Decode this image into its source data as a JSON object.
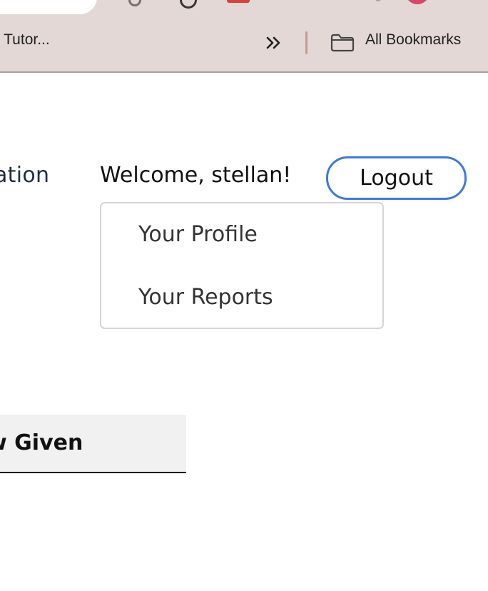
{
  "browser": {
    "bookmarks_bar": {
      "partial_item": "o Tutor...",
      "overflow_icon": "double-chevron-right-icon",
      "all_bookmarks_icon": "folder-icon",
      "all_bookmarks_label": "All Bookmarks"
    }
  },
  "header": {
    "nav_partial": "ation",
    "welcome": "Welcome, stellan!",
    "logout_label": "Logout"
  },
  "user_menu": {
    "items": [
      {
        "label": "Your Profile"
      },
      {
        "label": "Your Reports"
      }
    ]
  },
  "tabs": {
    "partial_label": "w Given"
  },
  "colors": {
    "chrome_bg": "#e4d8d6",
    "logout_border": "#3f78e0",
    "nav_text": "#1e2d4a",
    "avatar": "#d8466a"
  }
}
